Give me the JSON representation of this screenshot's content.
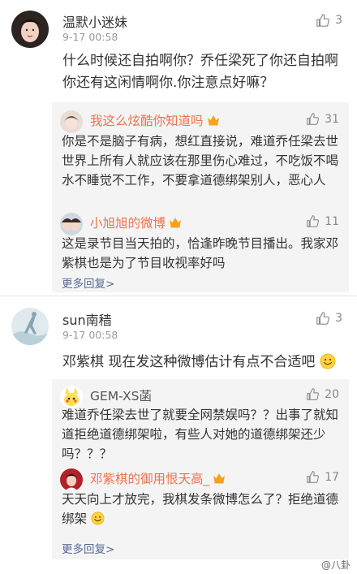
{
  "comments": [
    {
      "username": "温默小迷妹",
      "time": "9-17 00:58",
      "likes": "3",
      "text": "什么时候还自拍啊你？乔任梁死了你还自拍啊你还有这闲情啊你.你注意点好嘛？",
      "replies": [
        {
          "username": "我这么炫酷你知道吗",
          "likes": "31",
          "text": "你是不是脑子有病，想红直接说，难道乔任梁去世世界上所有人就应该在那里伤心难过，不吃饭不喝水不睡觉不工作，不要拿道德绑架别人，恶心人"
        },
        {
          "username": "小旭旭的微博",
          "likes": "11",
          "text": "这是录节目当天拍的，恰逢昨晚节目播出。我家邓紫棋也是为了节目收视率好吗"
        }
      ],
      "more_replies": "更多回复>"
    },
    {
      "username": "sun南穑",
      "time": "9-17 00:58",
      "likes": "3",
      "text": "邓紫棋 现在发这种微博估计有点不合适吧",
      "replies": [
        {
          "username": "GEM-XS菡",
          "likes": "20",
          "text": "难道乔任梁去世了就要全网禁娱吗？？出事了就知道拒绝道德绑架啦，有些人对她的道德绑架还少吗？？？"
        },
        {
          "username": "邓紫棋的御用恨天高_",
          "likes": "17",
          "text": "天天向上才放完，我棋发条微博怎么了？拒绝道德绑架"
        }
      ],
      "more_replies": "更多回复>"
    }
  ],
  "icons": [
    "thumbs-up-icon",
    "vip-badge-icon",
    "smile-emoji-icon"
  ],
  "colors": {
    "link": "#576b95",
    "vip_name": "#eb7350",
    "reply_bg": "#f4f4f4"
  },
  "watermark": "@八卦"
}
